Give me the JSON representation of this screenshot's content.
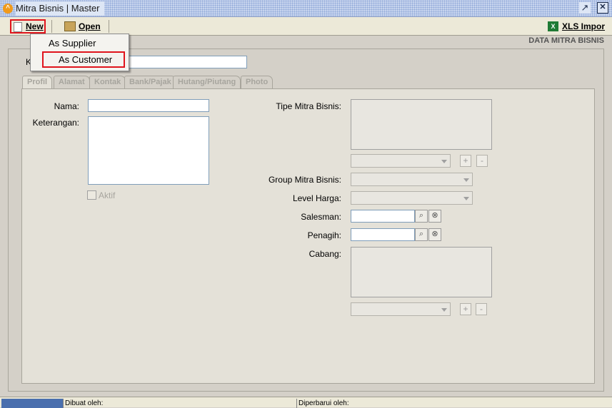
{
  "window": {
    "title": "Mitra Bisnis | Master",
    "logo_glyph": "^",
    "restore_glyph": "↗",
    "close_glyph": "✕"
  },
  "toolbar": {
    "new_label": "New",
    "open_label": "Open",
    "xls_label": "XLS Impor",
    "xls_icon_glyph": "X"
  },
  "dropdown": {
    "items": [
      {
        "label": "As Supplier"
      },
      {
        "label": "As Customer"
      }
    ]
  },
  "section": {
    "title": "DATA MITRA BISNIS",
    "code_label": "K",
    "code_value": ""
  },
  "tabs": [
    {
      "label": "Profil",
      "active": true
    },
    {
      "label": "Alamat"
    },
    {
      "label": "Kontak"
    },
    {
      "label": "Bank/Pajak"
    },
    {
      "label": "Hutang/Piutang"
    },
    {
      "label": "Photo"
    }
  ],
  "profil": {
    "nama_label": "Nama:",
    "nama_value": "",
    "keterangan_label": "Keterangan:",
    "keterangan_value": "",
    "aktif_label": "Aktif",
    "tipe_label": "Tipe Mitra Bisnis:",
    "group_label": "Group Mitra Bisnis:",
    "level_label": "Level Harga:",
    "salesman_label": "Salesman:",
    "salesman_value": "",
    "penagih_label": "Penagih:",
    "penagih_value": "",
    "cabang_label": "Cabang:",
    "plus_glyph": "+",
    "minus_glyph": "-",
    "search_glyph": "⌕",
    "clear_glyph": "⊗"
  },
  "status": {
    "dibuat_label": "Dibuat oleh:",
    "diperbarui_label": "Diperbarui oleh:"
  },
  "colors": {
    "highlight": "#e0141c",
    "titlebar": "#c7d4ee"
  }
}
